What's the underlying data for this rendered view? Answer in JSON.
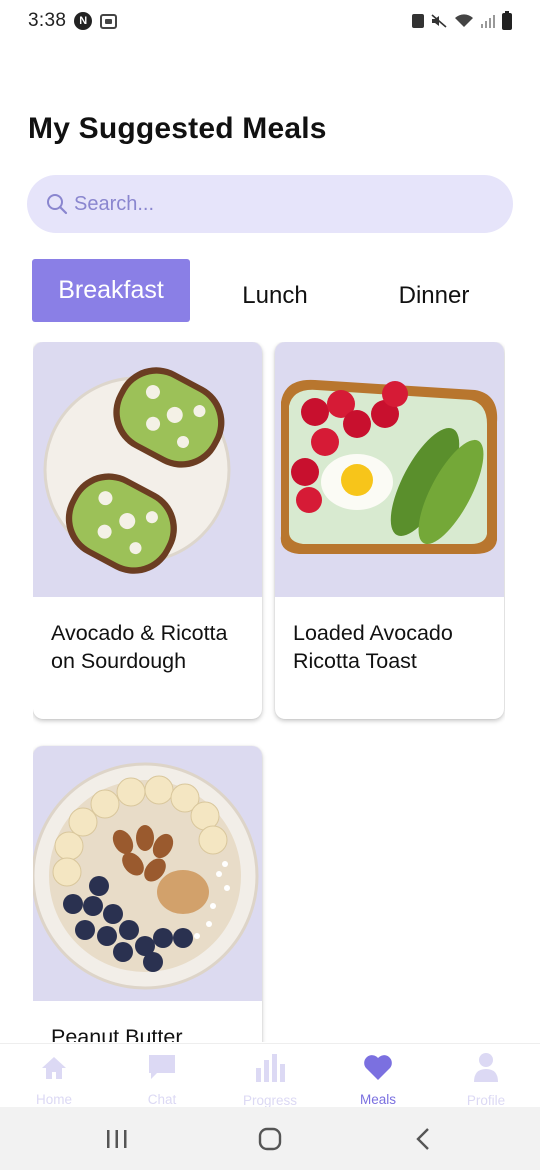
{
  "status_bar": {
    "time": "3:38",
    "nav_badge": "N",
    "icons": [
      "navigation-badge-icon",
      "screenshot-icon",
      "lock-icon",
      "mute-icon",
      "wifi-icon",
      "signal-icon",
      "battery-icon"
    ]
  },
  "page": {
    "title": "My Suggested Meals"
  },
  "search": {
    "placeholder": "Search..."
  },
  "tabs": [
    {
      "label": "Breakfast",
      "active": true
    },
    {
      "label": "Lunch",
      "active": false
    },
    {
      "label": "Dinner",
      "active": false
    }
  ],
  "meals": [
    {
      "title": "Avocado & Ricotta on Sourdough",
      "image": "avocado-ricotta-toast-photo"
    },
    {
      "title": "Loaded Avocado Ricotta Toast",
      "image": "loaded-avocado-toast-photo"
    },
    {
      "title": "Peanut Butter",
      "image": "oatmeal-bowl-photo"
    }
  ],
  "bottom_nav": [
    {
      "label": "Home",
      "icon": "home-icon",
      "active": false
    },
    {
      "label": "Chat",
      "icon": "chat-icon",
      "active": false
    },
    {
      "label": "Progress",
      "icon": "bar-chart-icon",
      "active": false
    },
    {
      "label": "Meals",
      "icon": "heart-icon",
      "active": true
    },
    {
      "label": "Profile",
      "icon": "user-icon",
      "active": false
    }
  ],
  "colors": {
    "accent": "#8a7fe6",
    "search_bg": "#e6e4fa",
    "card_image_bg": "#dcdaf0",
    "nav_inactive": "#dcd9f4",
    "nav_active": "#7b70e0"
  }
}
